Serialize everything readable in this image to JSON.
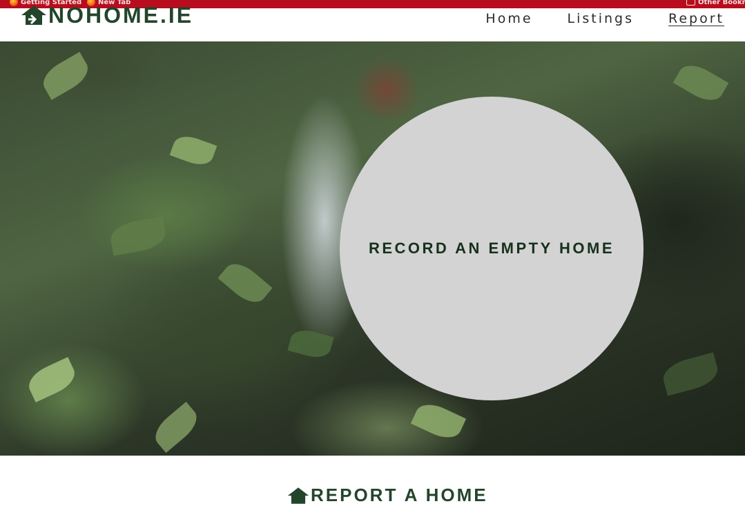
{
  "bookmarks": {
    "items": [
      {
        "label": "Getting Started",
        "icon": "firefox-icon"
      },
      {
        "label": "New Tab",
        "icon": "firefox-icon"
      }
    ],
    "other": {
      "label": "Other Bookm",
      "icon": "folder-icon"
    }
  },
  "header": {
    "logo_text": "NOHOME.IE",
    "logo_icon": "house-icon",
    "nav": [
      {
        "label": "Home"
      },
      {
        "label": "Listings"
      },
      {
        "label": "Report",
        "active": true
      }
    ]
  },
  "hero": {
    "cta_label": "RECORD AN EMPTY HOME"
  },
  "section": {
    "title": "REPORT A HOME",
    "icon": "house-icon"
  },
  "colors": {
    "brand_green": "#23452b",
    "bookmark_bar": "#b80d1e",
    "circle_bg": "#d3d3d3"
  }
}
